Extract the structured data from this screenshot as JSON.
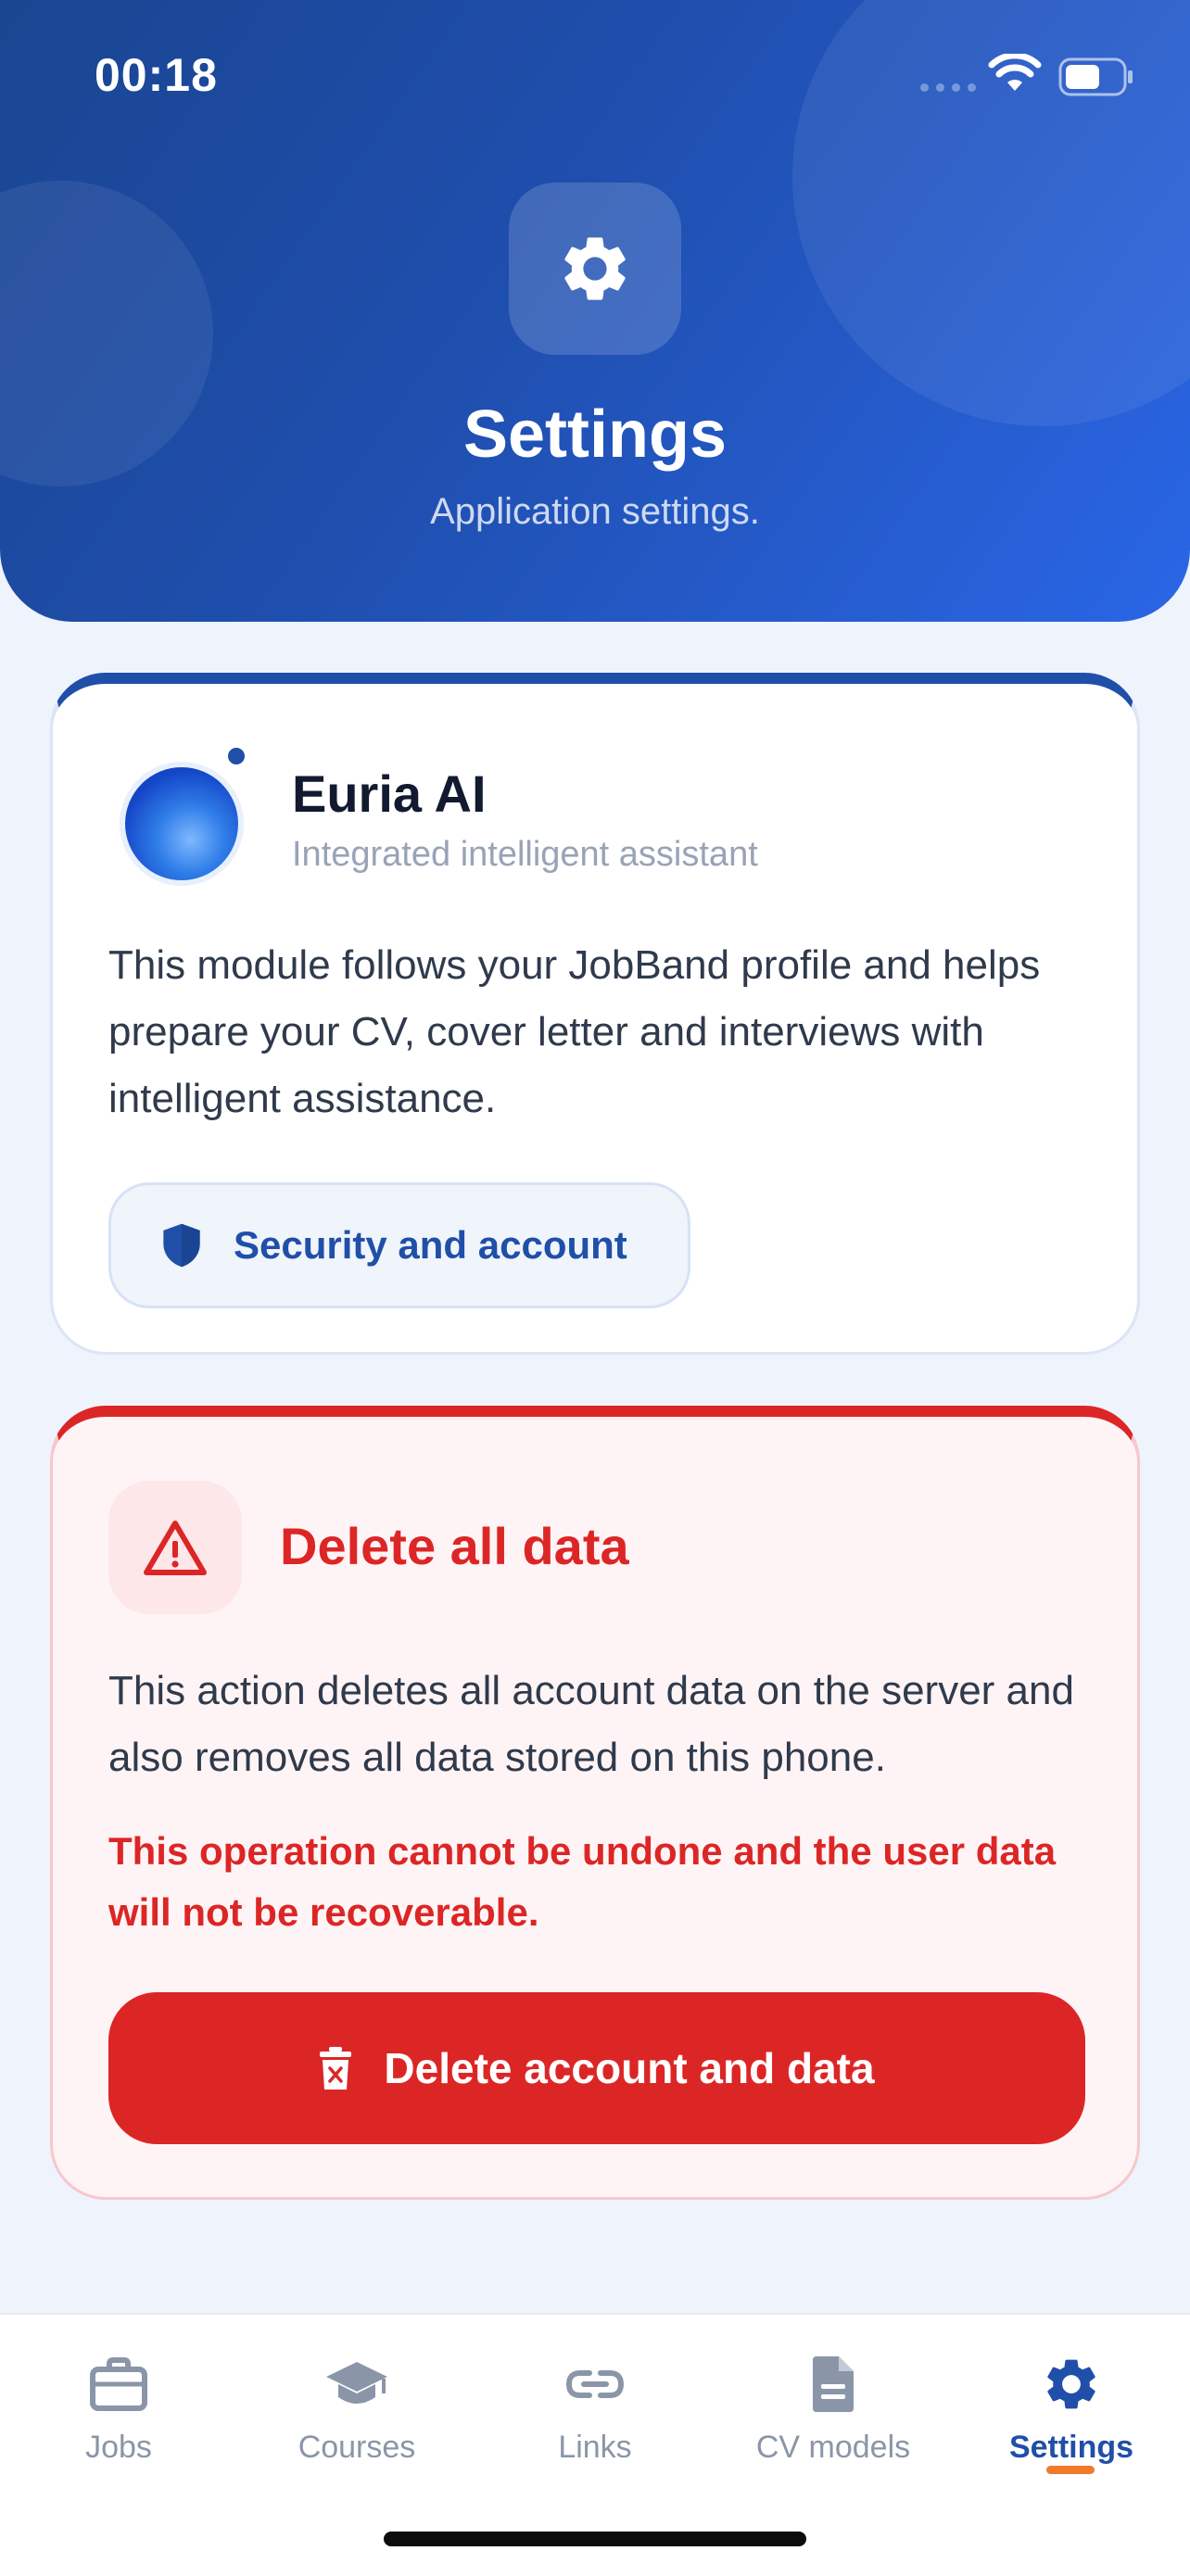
{
  "status_bar": {
    "time": "00:18"
  },
  "header": {
    "title": "Settings",
    "subtitle": "Application settings.",
    "icon": "gear-icon"
  },
  "euria_card": {
    "title": "Euria AI",
    "subtitle": "Integrated intelligent assistant",
    "description": "This module follows your JobBand profile and helps prepare your CV, cover letter and interviews with intelligent assistance.",
    "button_label": "Security and account",
    "button_icon": "shield-icon"
  },
  "danger_card": {
    "title": "Delete all data",
    "description": "This action deletes all account data on the server and also removes all data stored on this phone.",
    "warning": "This operation cannot be undone and the user data will not be recoverable.",
    "button_label": "Delete account and data",
    "button_icon": "trash-icon"
  },
  "tabbar": {
    "items": [
      {
        "label": "Jobs",
        "icon": "briefcase-icon",
        "active": false
      },
      {
        "label": "Courses",
        "icon": "graduation-cap-icon",
        "active": false
      },
      {
        "label": "Links",
        "icon": "link-icon",
        "active": false
      },
      {
        "label": "CV models",
        "icon": "document-icon",
        "active": false
      },
      {
        "label": "Settings",
        "icon": "gear-icon",
        "active": true
      }
    ]
  },
  "colors": {
    "primary": "#1f4fa8",
    "header_gradient_end": "#2a66e6",
    "danger": "#dc2626",
    "active_indicator": "#f07b2a",
    "background": "#eef3fc"
  }
}
